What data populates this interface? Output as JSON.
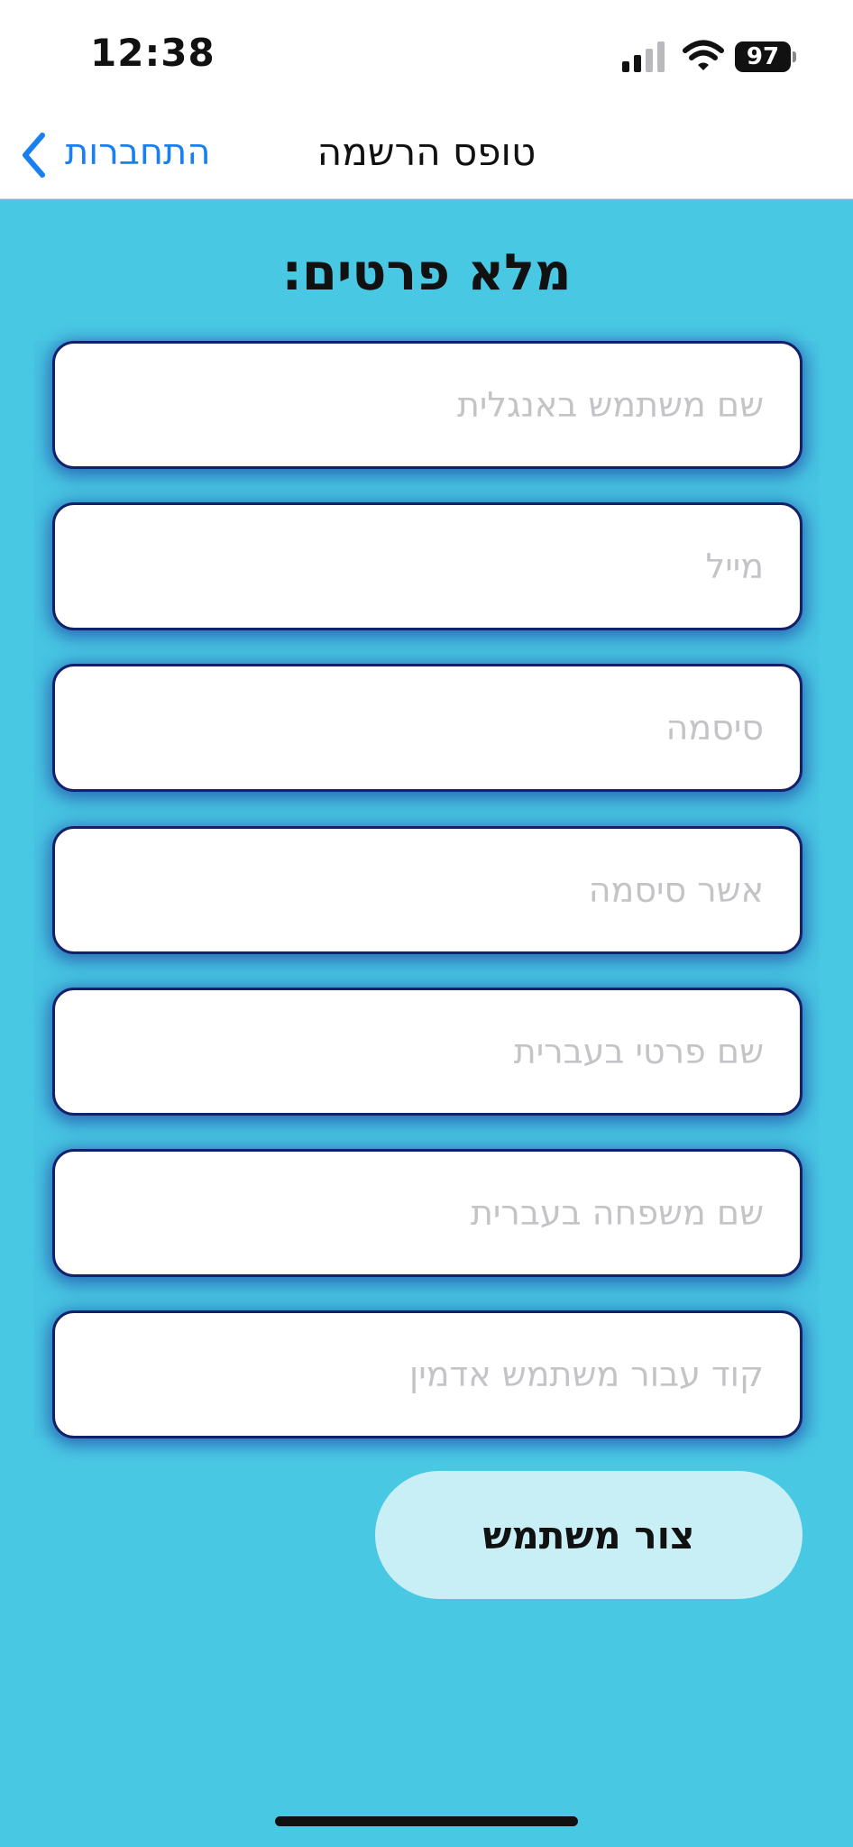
{
  "status_bar": {
    "time": "12:38",
    "battery": "97"
  },
  "nav": {
    "back_label": "התחברות",
    "title": "טופס הרשמה"
  },
  "form": {
    "title": "מלא פרטים:",
    "fields": [
      {
        "placeholder": "שם משתמש באנגלית",
        "value": ""
      },
      {
        "placeholder": "מייל",
        "value": ""
      },
      {
        "placeholder": "סיסמה",
        "value": ""
      },
      {
        "placeholder": "אשר סיסמה",
        "value": ""
      },
      {
        "placeholder": "שם פרטי בעברית",
        "value": ""
      },
      {
        "placeholder": "שם משפחה בעברית",
        "value": ""
      },
      {
        "placeholder": "קוד עבור משתמש אדמין",
        "value": ""
      }
    ],
    "submit_label": "צור משתמש"
  },
  "colors": {
    "background": "#49c8e4",
    "field_border": "#14206a",
    "link": "#1a7ff0",
    "button_fill": "#c9eff6"
  },
  "icons": [
    "signal-icon",
    "wifi-icon",
    "battery-icon",
    "chevron-left-icon"
  ]
}
